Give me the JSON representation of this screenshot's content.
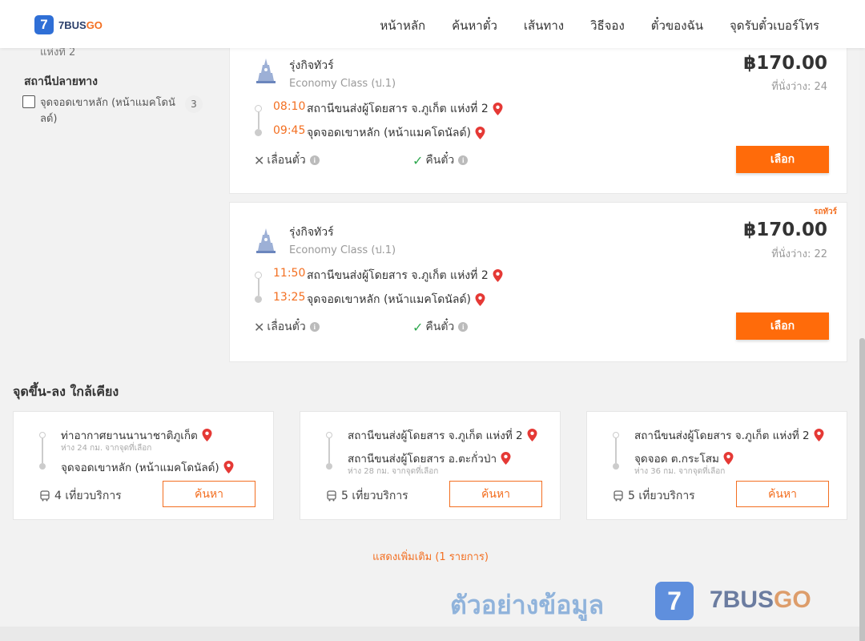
{
  "header": {
    "logo_mark": "7",
    "logo_brand": "7BUS",
    "logo_go": "GO",
    "nav": [
      "หน้าหลัก",
      "ค้นหาตั๋ว",
      "เส้นทาง",
      "วิธีจอง",
      "ตั๋วของฉัน",
      "จุดรับตั๋วเบอร์โทร"
    ]
  },
  "sidebar": {
    "cut_text": "แห่งที่ 2",
    "heading": "สถานีปลายทาง",
    "option_label": "จุดจอดเขาหลัก (หน้าแมคโดนัลด์)",
    "option_count": "3"
  },
  "trips": [
    {
      "badge": "",
      "operator": "รุ่งกิจทัวร์",
      "class": "Economy Class (ป.1)",
      "price": "฿170.00",
      "seats": "ที่นั่งว่าง: 24",
      "depart_time": "08:10",
      "depart_stop": "สถานีขนส่งผู้โดยสาร จ.ภูเก็ต แห่งที่ 2",
      "arrive_time": "09:45",
      "arrive_stop": "จุดจอดเขาหลัก (หน้าแมคโดนัลด์)",
      "reschedule": "เลื่อนตั๋ว",
      "refund": "คืนตั๋ว",
      "select": "เลือก"
    },
    {
      "badge": "รถทัวร์",
      "operator": "รุ่งกิจทัวร์",
      "class": "Economy Class (ป.1)",
      "price": "฿170.00",
      "seats": "ที่นั่งว่าง: 22",
      "depart_time": "11:50",
      "depart_stop": "สถานีขนส่งผู้โดยสาร จ.ภูเก็ต แห่งที่ 2",
      "arrive_time": "13:25",
      "arrive_stop": "จุดจอดเขาหลัก (หน้าแมคโดนัลด์)",
      "reschedule": "เลื่อนตั๋ว",
      "refund": "คืนตั๋ว",
      "select": "เลือก"
    }
  ],
  "nearby": {
    "title": "จุดขึ้น-ลง ใกล้เคียง",
    "items": [
      {
        "from": "ท่าอากาศยานนานาชาติภูเก็ต",
        "from_dist": "ห่าง 24 กม. จากจุดที่เลือก",
        "to": "จุดจอดเขาหลัก (หน้าแมคโดนัลด์)",
        "to_dist": "",
        "trips": "4 เที่ยวบริการ",
        "button": "ค้นหา"
      },
      {
        "from": "สถานีขนส่งผู้โดยสาร จ.ภูเก็ต แห่งที่ 2",
        "from_dist": "",
        "to": "สถานีขนส่งผู้โดยสาร อ.ตะกั่วป่า",
        "to_dist": "ห่าง 28 กม. จากจุดที่เลือก",
        "trips": "5 เที่ยวบริการ",
        "button": "ค้นหา"
      },
      {
        "from": "สถานีขนส่งผู้โดยสาร จ.ภูเก็ต แห่งที่ 2",
        "from_dist": "",
        "to": "จุดจอด ต.กระโสม",
        "to_dist": "ห่าง 36 กม. จากจุดที่เลือก",
        "trips": "5 เที่ยวบริการ",
        "button": "ค้นหา"
      }
    ]
  },
  "show_more": "แสดงเพิ่มเติม (1 รายการ)",
  "watermark": {
    "text": "ตัวอย่างข้อมูล",
    "mark": "7",
    "brand": "7BUS",
    "go": "GO"
  },
  "colors": {
    "accent": "#ff6b0a",
    "brand_blue": "#2f6fd6",
    "refund_green": "#2fa84f",
    "pin_red": "#e53935"
  },
  "icons": [
    "logo-icon",
    "bus-operator-logo",
    "map-pin-icon",
    "cross-icon",
    "check-icon",
    "info-icon",
    "bus-icon",
    "checkbox"
  ]
}
